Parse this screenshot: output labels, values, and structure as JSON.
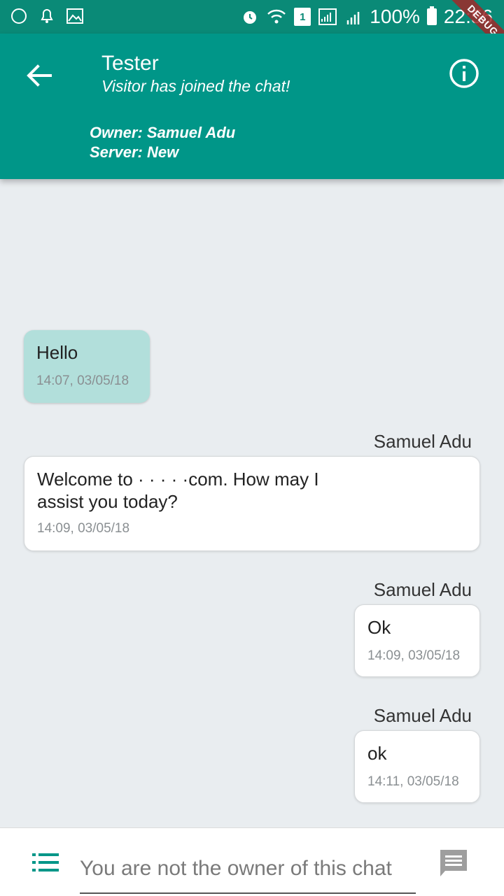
{
  "status_bar": {
    "sim_number": "1",
    "battery": "100%",
    "time": "22:56",
    "debug_label": "DEBUG"
  },
  "header": {
    "title": "Tester",
    "subtitle": "Visitor has joined the chat!",
    "owner": "Owner: Samuel Adu",
    "server": "Server: New"
  },
  "messages": [
    {
      "from": "visitor",
      "text": "Hello",
      "time": "14:07, 03/05/18"
    },
    {
      "from": "agent",
      "sender": "Samuel Adu",
      "line1": "Welcome to ·  ·     ·    ·        ·com. How may I",
      "line2": "assist you today?",
      "time": "14:09, 03/05/18"
    },
    {
      "from": "agent",
      "sender": "Samuel Adu",
      "text": "Ok",
      "time": "14:09, 03/05/18"
    },
    {
      "from": "agent",
      "sender": "Samuel Adu",
      "text": "ok",
      "time": "14:11, 03/05/18"
    }
  ],
  "input": {
    "placeholder": "You are not the owner of this chat"
  },
  "icons": {
    "back": "arrow-back-icon",
    "info": "info-icon",
    "menu": "list-icon",
    "send": "message-icon"
  },
  "colors": {
    "primary": "#009688",
    "status_bar": "#0a8a77",
    "visitor_bubble": "#b2dfdb",
    "background": "#e9edf0"
  }
}
